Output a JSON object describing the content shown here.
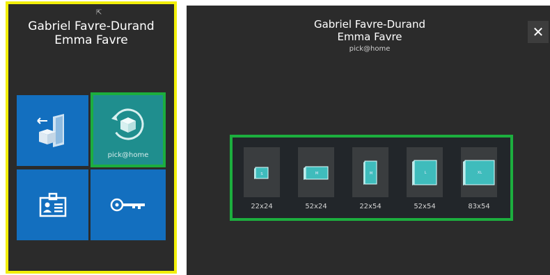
{
  "left_panel": {
    "name_line1": "Gabriel Favre-Durand",
    "name_line2": "Emma Favre",
    "tiles": [
      {
        "id": "return",
        "icon": "return-package-icon",
        "label": ""
      },
      {
        "id": "pickathome",
        "icon": "pick-at-home-icon",
        "label": "pick@home"
      },
      {
        "id": "id-card",
        "icon": "id-card-icon",
        "label": ""
      },
      {
        "id": "key",
        "icon": "key-icon",
        "label": ""
      }
    ]
  },
  "right_panel": {
    "name_line1": "Gabriel Favre-Durand",
    "name_line2": "Emma Favre",
    "service": "pick@home",
    "close_label": "✕",
    "sizes": [
      {
        "label": "22x24",
        "badge": "S"
      },
      {
        "label": "52x24",
        "badge": "M"
      },
      {
        "label": "22x54",
        "badge": "M"
      },
      {
        "label": "52x54",
        "badge": "L"
      },
      {
        "label": "83x54",
        "badge": "XL"
      }
    ]
  },
  "colors": {
    "panel_bg": "#2b2b2b",
    "tile_blue": "#136fbf",
    "tile_teal": "#1f8e8e",
    "highlight_green": "#1cae3e",
    "highlight_yellow": "#f2ef0a"
  }
}
